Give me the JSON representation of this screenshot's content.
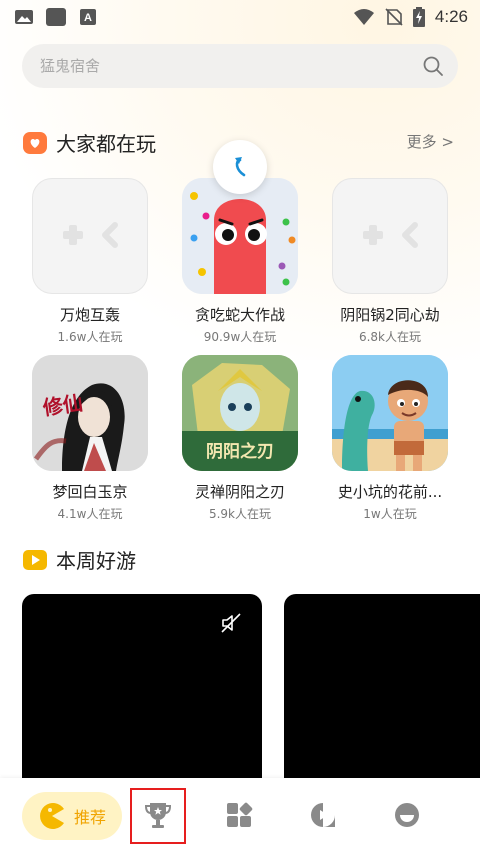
{
  "status_bar": {
    "time": "4:26",
    "left_icons": [
      "gallery-icon",
      "app-icon",
      "a-icon"
    ],
    "right_icons": [
      "wifi-icon",
      "no-sim-icon",
      "battery-charging-icon"
    ]
  },
  "search": {
    "placeholder": "猛鬼宿舍"
  },
  "section_popular": {
    "title": "大家都在玩",
    "more_label": "更多 >",
    "icon": "heart-badge-icon"
  },
  "games": [
    {
      "name": "万炮互轰",
      "players": "1.6w人在玩",
      "icon": "gamepad-placeholder-icon"
    },
    {
      "name": "贪吃蛇大作战",
      "players": "90.9w人在玩",
      "icon": "snake-game-icon"
    },
    {
      "name": "阴阳锅2同心劫",
      "players": "6.8k人在玩",
      "icon": "gamepad-placeholder-icon"
    },
    {
      "name": "梦回白玉京",
      "players": "4.1w人在玩",
      "icon": "xiuxian-game-icon"
    },
    {
      "name": "灵禅阴阳之刃",
      "players": "5.9k人在玩",
      "icon": "yinyang-blade-game-icon"
    },
    {
      "name": "史小坑的花前...",
      "players": "1w人在玩",
      "icon": "cartoon-boy-game-icon"
    }
  ],
  "section_weekly": {
    "title": "本周好游",
    "icon": "play-badge-icon"
  },
  "tab_bar": {
    "home_label": "推荐",
    "tabs": [
      "home-tab",
      "trophy-tab",
      "categories-tab",
      "video-tab",
      "profile-tab"
    ]
  },
  "colors": {
    "accent": "#f0a400",
    "search_bg": "#f1f0ee",
    "highlight": "#e61e1e"
  },
  "icon_texts": {
    "xiuxian": "修仙",
    "yinyang": "阴阳之刃"
  }
}
